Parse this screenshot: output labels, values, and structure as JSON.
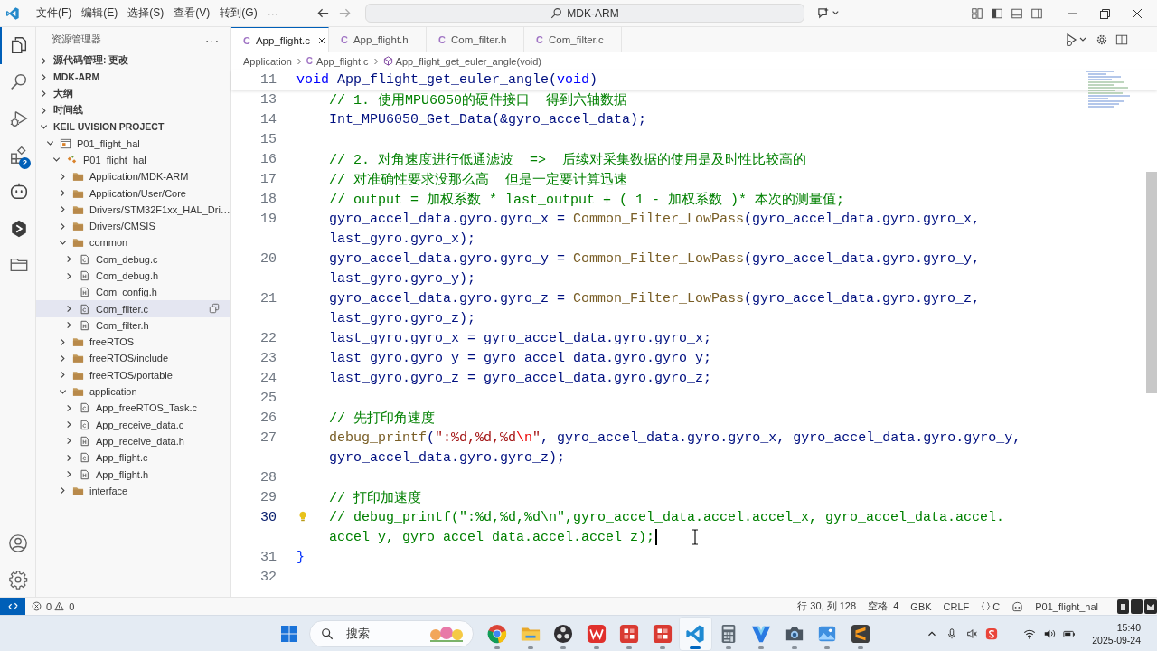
{
  "title_bar": {
    "menus": [
      "文件(F)",
      "编辑(E)",
      "选择(S)",
      "查看(V)",
      "转到(G)"
    ],
    "more": "···",
    "command_center": "MDK-ARM"
  },
  "activity_bar": {
    "items": [
      {
        "kind": "explorer",
        "selected": true
      },
      {
        "kind": "search",
        "selected": false
      },
      {
        "kind": "debug",
        "selected": false
      },
      {
        "kind": "extensions",
        "selected": false,
        "badge": "2"
      },
      {
        "kind": "chat",
        "selected": false
      },
      {
        "kind": "hexagon",
        "selected": false
      },
      {
        "kind": "project",
        "selected": false
      }
    ]
  },
  "sidebar": {
    "title": "资源管理器",
    "more": "···",
    "sections": [
      {
        "label": "源代码管理: 更改",
        "expanded": false
      },
      {
        "label": "MDK-ARM",
        "expanded": false
      },
      {
        "label": "大纲",
        "expanded": false
      },
      {
        "label": "时间线",
        "expanded": false
      },
      {
        "label": "KEIL UVISION PROJECT",
        "expanded": true,
        "tree": [
          {
            "label": "P01_flight_hal",
            "kind": "project",
            "expandable": true,
            "expanded": true,
            "selected": false,
            "children": [
              {
                "label": "P01_flight_hal",
                "kind": "target",
                "expandable": true,
                "expanded": true,
                "selected": false,
                "children": [
                  {
                    "label": "Application/MDK-ARM",
                    "kind": "folder",
                    "expandable": true,
                    "expanded": false,
                    "selected": false
                  },
                  {
                    "label": "Application/User/Core",
                    "kind": "folder",
                    "expandable": true,
                    "expanded": false,
                    "selected": false
                  },
                  {
                    "label": "Drivers/STM32F1xx_HAL_Dri…",
                    "kind": "folder",
                    "expandable": true,
                    "expanded": false,
                    "selected": false
                  },
                  {
                    "label": "Drivers/CMSIS",
                    "kind": "folder",
                    "expandable": true,
                    "expanded": false,
                    "selected": false
                  },
                  {
                    "label": "common",
                    "kind": "folder",
                    "expandable": true,
                    "expanded": true,
                    "selected": false,
                    "children": [
                      {
                        "label": "Com_debug.c",
                        "kind": "c-file",
                        "expandable": true,
                        "selected": false
                      },
                      {
                        "label": "Com_debug.h",
                        "kind": "h-file",
                        "expandable": true,
                        "selected": false
                      },
                      {
                        "label": "Com_config.h",
                        "kind": "h-file",
                        "expandable": false,
                        "selected": false
                      },
                      {
                        "label": "Com_filter.c",
                        "kind": "c-file",
                        "expandable": true,
                        "selected": true
                      },
                      {
                        "label": "Com_filter.h",
                        "kind": "h-file",
                        "expandable": true,
                        "selected": false
                      }
                    ]
                  },
                  {
                    "label": "freeRTOS",
                    "kind": "folder",
                    "expandable": true,
                    "expanded": false,
                    "selected": false
                  },
                  {
                    "label": "freeRTOS/include",
                    "kind": "folder",
                    "expandable": true,
                    "expanded": false,
                    "selected": false
                  },
                  {
                    "label": "freeRTOS/portable",
                    "kind": "folder",
                    "expandable": true,
                    "expanded": false,
                    "selected": false
                  },
                  {
                    "label": "application",
                    "kind": "folder",
                    "expandable": true,
                    "expanded": true,
                    "selected": false,
                    "children": [
                      {
                        "label": "App_freeRTOS_Task.c",
                        "kind": "c-file",
                        "expandable": true,
                        "selected": false
                      },
                      {
                        "label": "App_receive_data.c",
                        "kind": "c-file",
                        "expandable": true,
                        "selected": false
                      },
                      {
                        "label": "App_receive_data.h",
                        "kind": "h-file",
                        "expandable": true,
                        "selected": false
                      },
                      {
                        "label": "App_flight.c",
                        "kind": "c-file",
                        "expandable": true,
                        "selected": false
                      },
                      {
                        "label": "App_flight.h",
                        "kind": "h-file",
                        "expandable": true,
                        "selected": false
                      }
                    ]
                  },
                  {
                    "label": "interface",
                    "kind": "folder",
                    "expandable": true,
                    "expanded": false,
                    "selected": false
                  }
                ]
              }
            ]
          }
        ]
      }
    ]
  },
  "editor": {
    "tabs": [
      {
        "icon": "C",
        "label": "App_flight.c",
        "selected": true
      },
      {
        "icon": "C",
        "label": "App_flight.h",
        "selected": false
      },
      {
        "icon": "C",
        "label": "Com_filter.h",
        "selected": false
      },
      {
        "icon": "C",
        "label": "Com_filter.c",
        "selected": false
      }
    ],
    "breadcrumb": [
      {
        "kind": "folder",
        "label": "Application"
      },
      {
        "kind": "file",
        "icon": "C",
        "label": "App_flight.c"
      },
      {
        "kind": "symbol",
        "label": "App_flight_get_euler_angle(void)"
      }
    ],
    "lines": [
      {
        "number": "11",
        "current": false,
        "rows": [
          [
            {
              "kind": "keyword",
              "text": "void"
            },
            {
              "kind": "plain",
              "text": " App_flight_get_euler_angle("
            },
            {
              "kind": "keyword",
              "text": "void"
            },
            {
              "kind": "plain",
              "text": ")"
            }
          ]
        ],
        "children": [
          {
            "number": "13",
            "current": false,
            "rows": [
              [
                {
                  "kind": "comment",
                  "text": "// 1. 使用MPU6050的硬件接口  得到六轴数据"
                }
              ]
            ]
          },
          {
            "number": "14",
            "current": false,
            "rows": [
              [
                {
                  "kind": "plain",
                  "text": "Int_MPU6050_Get_Data(&gyro_accel_data);"
                }
              ]
            ]
          },
          {
            "number": "15",
            "current": false
          },
          {
            "number": "16",
            "current": false,
            "rows": [
              [
                {
                  "kind": "comment",
                  "text": "// 2. 对角速度进行低通滤波  =>  后续对采集数据的使用是及时性比较高的"
                }
              ]
            ]
          },
          {
            "number": "17",
            "current": false,
            "rows": [
              [
                {
                  "kind": "comment",
                  "text": "// 对准确性要求没那么高  但是一定要计算迅速"
                }
              ]
            ]
          },
          {
            "number": "18",
            "current": false,
            "rows": [
              [
                {
                  "kind": "comment",
                  "text": "// output = 加权系数 * last_output + ( 1 - 加权系数 )* 本次的测量值;"
                }
              ]
            ]
          },
          {
            "number": "19",
            "current": false,
            "rows": [
              [
                {
                  "kind": "plain",
                  "text": "gyro_accel_data.gyro.gyro_x = "
                },
                {
                  "kind": "function",
                  "text": "Common_Filter_LowPass"
                },
                {
                  "kind": "plain",
                  "text": "(gyro_accel_data.gyro.gyro_x,"
                }
              ],
              [
                {
                  "kind": "plain",
                  "text": "last_gyro.gyro_x);"
                }
              ]
            ]
          },
          {
            "number": "20",
            "current": false,
            "rows": [
              [
                {
                  "kind": "plain",
                  "text": "gyro_accel_data.gyro.gyro_y = "
                },
                {
                  "kind": "function",
                  "text": "Common_Filter_LowPass"
                },
                {
                  "kind": "plain",
                  "text": "(gyro_accel_data.gyro.gyro_y,"
                }
              ],
              [
                {
                  "kind": "plain",
                  "text": "last_gyro.gyro_y);"
                }
              ]
            ]
          },
          {
            "number": "21",
            "current": false,
            "rows": [
              [
                {
                  "kind": "plain",
                  "text": "gyro_accel_data.gyro.gyro_z = "
                },
                {
                  "kind": "function",
                  "text": "Common_Filter_LowPass"
                },
                {
                  "kind": "plain",
                  "text": "(gyro_accel_data.gyro.gyro_z,"
                }
              ],
              [
                {
                  "kind": "plain",
                  "text": "last_gyro.gyro_z);"
                }
              ]
            ]
          },
          {
            "number": "22",
            "current": false,
            "rows": [
              [
                {
                  "kind": "plain",
                  "text": "last_gyro.gyro_x = gyro_accel_data.gyro.gyro_x;"
                }
              ]
            ]
          },
          {
            "number": "23",
            "current": false,
            "rows": [
              [
                {
                  "kind": "plain",
                  "text": "last_gyro.gyro_y = gyro_accel_data.gyro.gyro_y;"
                }
              ]
            ]
          },
          {
            "number": "24",
            "current": false,
            "rows": [
              [
                {
                  "kind": "plain",
                  "text": "last_gyro.gyro_z = gyro_accel_data.gyro.gyro_z;"
                }
              ]
            ]
          },
          {
            "number": "25",
            "current": false
          },
          {
            "number": "26",
            "current": false,
            "rows": [
              [
                {
                  "kind": "comment",
                  "text": "// 先打印角速度"
                }
              ]
            ]
          },
          {
            "number": "27",
            "current": false,
            "rows": [
              [
                {
                  "kind": "function",
                  "text": "debug_printf"
                },
                {
                  "kind": "plain",
                  "text": "("
                },
                {
                  "kind": "string",
                  "text": "\":%d,%d,%d"
                },
                {
                  "kind": "escape",
                  "text": "\\n"
                },
                {
                  "kind": "string",
                  "text": "\""
                },
                {
                  "kind": "plain",
                  "text": ", gyro_accel_data.gyro.gyro_x, gyro_accel_data.gyro.gyro_y,"
                }
              ],
              [
                {
                  "kind": "plain",
                  "text": "gyro_accel_data.gyro.gyro_z);"
                }
              ]
            ]
          },
          {
            "number": "28",
            "current": false
          },
          {
            "number": "29",
            "current": false,
            "rows": [
              [
                {
                  "kind": "comment",
                  "text": "// 打印加速度"
                }
              ]
            ]
          },
          {
            "number": "30",
            "current": true,
            "rows": [
              [
                {
                  "kind": "comment",
                  "text": "// debug_printf(\":%d,%d,%d\\n\",gyro_accel_data.accel.accel_x, gyro_accel_data.accel."
                }
              ],
              [
                {
                  "kind": "comment",
                  "text": "accel_y, gyro_accel_data.accel.accel_z);"
                }
              ]
            ]
          }
        ]
      },
      {
        "number": "31",
        "current": false,
        "rows": [
          [
            {
              "kind": "bracket",
              "text": "}"
            }
          ]
        ]
      },
      {
        "number": "32",
        "current": false
      }
    ]
  },
  "status_bar": {
    "errors": "0",
    "warnings": "0",
    "items": [
      {
        "kind": "text",
        "label": "行 30, 列 128"
      },
      {
        "kind": "text",
        "label": "空格: 4"
      },
      {
        "kind": "text",
        "label": "GBK"
      },
      {
        "kind": "text",
        "label": "CRLF"
      },
      {
        "kind": "language",
        "label": "C"
      },
      {
        "kind": "copilot"
      },
      {
        "kind": "text",
        "label": "P01_flight_hal"
      }
    ]
  },
  "taskbar": {
    "search": {
      "placeholder": "搜索"
    },
    "apps": [
      {
        "kind": "browser",
        "selected": false
      },
      {
        "kind": "files",
        "selected": false
      },
      {
        "kind": "recorder",
        "selected": false
      },
      {
        "kind": "office",
        "selected": false
      },
      {
        "kind": "red-app",
        "selected": false
      },
      {
        "kind": "red-app",
        "selected": false
      },
      {
        "kind": "code",
        "selected": true
      },
      {
        "kind": "calculator",
        "selected": false
      },
      {
        "kind": "v-app",
        "selected": false
      },
      {
        "kind": "camera",
        "selected": false
      },
      {
        "kind": "photos",
        "selected": false
      },
      {
        "kind": "sublime",
        "selected": false
      }
    ],
    "time": "15:40",
    "date": "2025-09-24"
  }
}
